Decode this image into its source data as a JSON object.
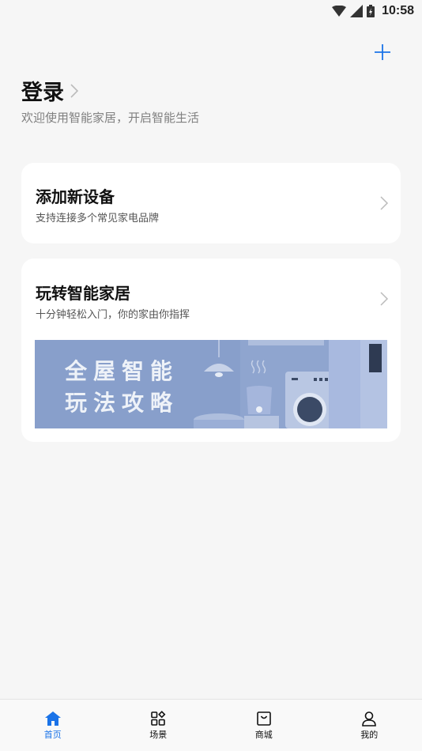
{
  "status_bar": {
    "time": "10:58"
  },
  "header": {
    "login_label": "登录",
    "subtitle": "欢迎使用智能家居，开启智能生活"
  },
  "cards": [
    {
      "title": "添加新设备",
      "subtitle": "支持连接多个常见家电品牌"
    },
    {
      "title": "玩转智能家居",
      "subtitle": "十分钟轻松入门，你的家由你指挥",
      "banner": {
        "line1": "全屋智能",
        "line2": "玩法攻略"
      }
    }
  ],
  "tabbar": {
    "tabs": [
      {
        "label": "首页",
        "icon": "home-icon",
        "active": true
      },
      {
        "label": "场景",
        "icon": "scene-grid-icon",
        "active": false
      },
      {
        "label": "商城",
        "icon": "shopping-bag-icon",
        "active": false
      },
      {
        "label": "我的",
        "icon": "person-icon",
        "active": false
      }
    ]
  },
  "colors": {
    "accent": "#1a73e8",
    "background": "#f6f6f6",
    "banner_bg": "#8fa5cf"
  }
}
